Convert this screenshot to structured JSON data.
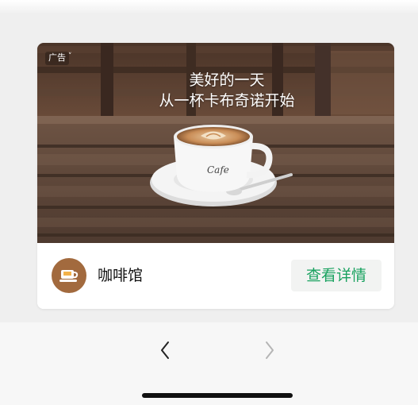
{
  "ad": {
    "label": "广告",
    "headline_line1": "美好的一天",
    "headline_line2": "从一杯卡布奇诺开始",
    "cup_script": "Cafe",
    "brand_name": "咖啡馆",
    "cta_label": "查看详情"
  },
  "nav": {
    "back_icon": "chevron-left-icon",
    "forward_icon": "chevron-right-icon"
  },
  "colors": {
    "cta_text": "#1aa260",
    "avatar_bg": "#a26a3e"
  }
}
